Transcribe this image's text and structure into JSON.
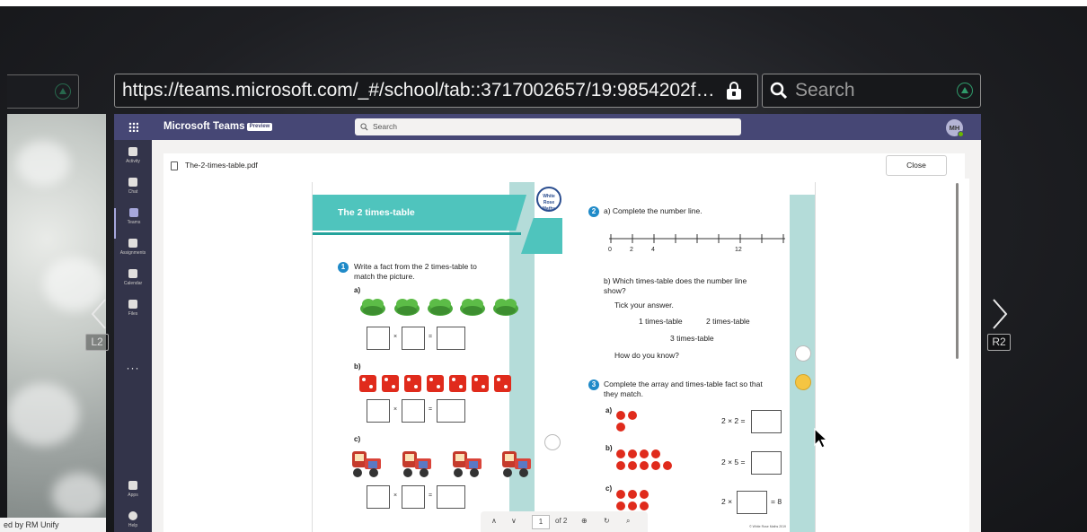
{
  "left_panel": {
    "footer_text": "ed by RM Unify"
  },
  "browser": {
    "url": "https://teams.microsoft.com/_#/school/tab::3717002657/19:9854202f…",
    "search_placeholder": "Search",
    "left_badge": "L2",
    "right_badge": "R2"
  },
  "teams": {
    "app_title": "Microsoft Teams",
    "preview_label": "Preview",
    "search_placeholder": "Search",
    "avatar_initials": "MH",
    "rail": [
      {
        "label": "Activity",
        "icon": "bell-icon"
      },
      {
        "label": "Chat",
        "icon": "chat-icon"
      },
      {
        "label": "Teams",
        "icon": "teams-icon"
      },
      {
        "label": "Assignments",
        "icon": "assignments-icon"
      },
      {
        "label": "Calendar",
        "icon": "calendar-icon"
      },
      {
        "label": "Files",
        "icon": "files-icon"
      }
    ],
    "rail_more": "···",
    "rail_bottom": [
      {
        "label": "Apps",
        "icon": "apps-icon"
      },
      {
        "label": "Help",
        "icon": "help-icon"
      }
    ],
    "file_name": "The-2-times-table.pdf",
    "close_label": "Close",
    "pagebar": {
      "current_page": "1",
      "of_pages": "of 2"
    }
  },
  "worksheet": {
    "title": "The 2 times-table",
    "logo": "White Rose Maths",
    "q1_num": "1",
    "q1_text": "Write a fact from the 2 times-table to match the picture.",
    "q1_a": "a)",
    "q1_b": "b)",
    "q1_c": "c)",
    "times_sign": "×",
    "equals_sign": "=",
    "q2_num": "2",
    "q2_a": "a) Complete the number line.",
    "numberline_labels": [
      "0",
      "2",
      "4",
      "12"
    ],
    "q2_b": "b) Which times-table does the number line show?",
    "q2_tick": "Tick your answer.",
    "q2_opt1": "1 times-table",
    "q2_opt2": "2 times-table",
    "q2_opt3": "3 times-table",
    "q2_how": "How do you know?",
    "q3_num": "3",
    "q3_text": "Complete the array and times-table fact so that they match.",
    "q3_a": "a)",
    "q3_b": "b)",
    "q3_c": "c)",
    "q3_a_fact": "2 × 2 =",
    "q3_b_fact": "2 × 5 =",
    "q3_c_fact_pre": "2 ×",
    "q3_c_fact_post": "= 8",
    "copyright": "© White Rose Maths 2019"
  },
  "colors": {
    "teams_header": "#464775",
    "teams_rail": "#33344a",
    "banner": "#4fc4bd",
    "accent_green": "#2f9a6a"
  }
}
